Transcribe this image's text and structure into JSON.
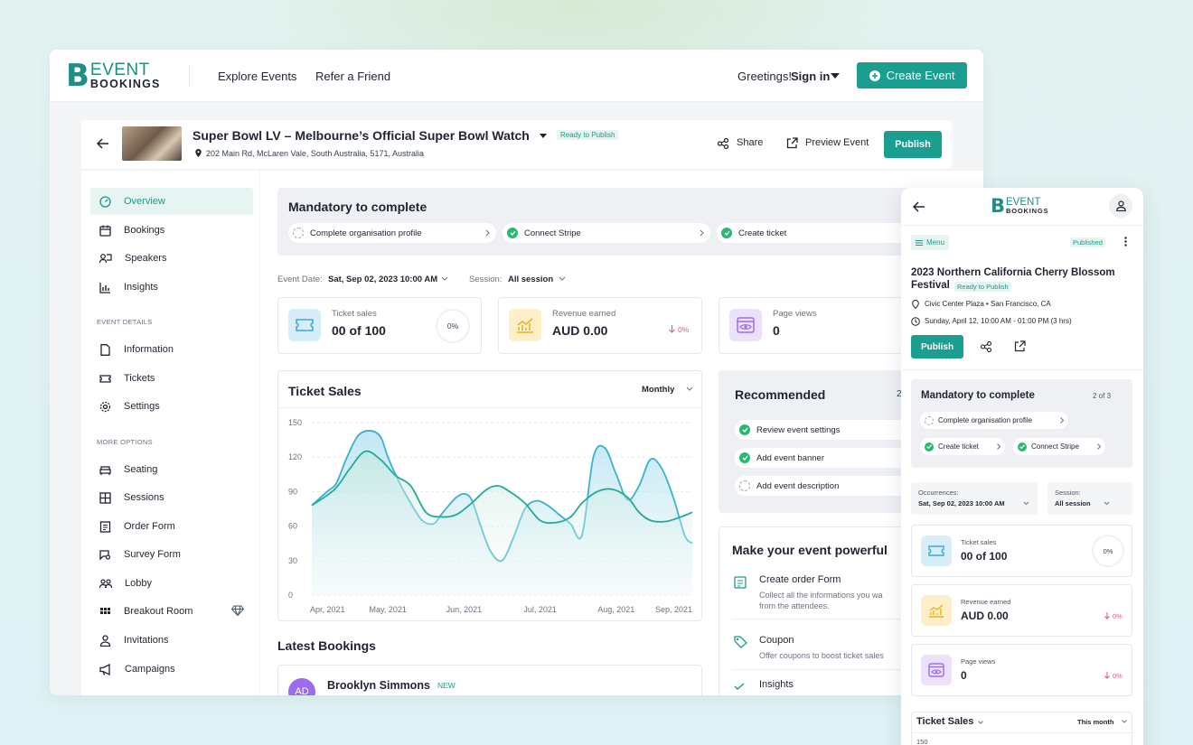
{
  "nav": {
    "logo_line1": "EVENT",
    "logo_line2": "BOOKINGS",
    "explore": "Explore Events",
    "refer": "Refer a Friend",
    "greeting": "Greetings!",
    "signin": "Sign in",
    "create": "Create Event"
  },
  "event": {
    "title": "Super Bowl LV – Melbourne’s Official Super Bowl Watch",
    "status": "Ready to Publish",
    "address": "202 Main Rd, McLaren Vale, South Australia, 5171, Australia",
    "share": "Share",
    "preview": "Preview Event",
    "publish": "Publish"
  },
  "sidebar": {
    "overview": "Overview",
    "bookings": "Bookings",
    "speakers": "Speakers",
    "insights": "Insights",
    "sec_details": "EVENT DETAILS",
    "information": "Information",
    "tickets": "Tickets",
    "settings": "Settings",
    "sec_more": "MORE OPTIONS",
    "seating": "Seating",
    "sessions": "Sessions",
    "order_form": "Order Form",
    "survey_form": "Survey Form",
    "lobby": "Lobby",
    "breakout": "Breakout Room",
    "invitations": "Invitations",
    "campaigns": "Campaigns"
  },
  "mandatory": {
    "title": "Mandatory to complete",
    "item1": "Complete organisation profile",
    "item2": "Connect Stripe",
    "item3": "Create ticket"
  },
  "filters": {
    "date_label": "Event Date:",
    "date_value": "Sat, Sep 02, 2023 10:00 AM",
    "session_label": "Session:",
    "session_value": "All session"
  },
  "stats": {
    "tickets_label": "Ticket sales",
    "tickets_value": "00 of 100",
    "tickets_pct": "0%",
    "revenue_label": "Revenue earned",
    "revenue_value": "AUD 0.00",
    "revenue_change": "0%",
    "views_label": "Page views",
    "views_value": "0"
  },
  "chart_data": {
    "type": "area",
    "title": "Ticket Sales",
    "period": "Monthly",
    "categories": [
      "Apr, 2021",
      "May, 2021",
      "Jun, 2021",
      "Jul, 2021",
      "Aug, 2021",
      "Sep, 2021"
    ],
    "yticks": [
      150,
      120,
      90,
      60,
      30,
      0
    ],
    "ylim": [
      0,
      150
    ],
    "series": [
      {
        "x": [
          0,
          0.2,
          0.32,
          0.45,
          0.6,
          0.75,
          0.9,
          1,
          1.15,
          1.3,
          1.45,
          1.6,
          1.7,
          1.8,
          1.9,
          2.0,
          2.1,
          2.22,
          2.35,
          2.5,
          2.65,
          2.8,
          2.95,
          3.1,
          3.25,
          3.4,
          3.55,
          3.7,
          3.85,
          4.0,
          4.15,
          4.3,
          4.45,
          4.6,
          4.75,
          4.9,
          5.0
        ],
        "y": [
          78,
          90,
          97,
          118,
          138,
          143,
          138,
          120,
          98,
          80,
          65,
          62,
          70,
          78,
          85,
          88,
          83,
          60,
          38,
          30,
          50,
          75,
          82,
          78,
          70,
          62,
          52,
          120,
          128,
          105,
          83,
          95,
          118,
          110,
          85,
          52,
          45
        ]
      },
      {
        "x": [
          0,
          0.3,
          0.5,
          0.7,
          0.9,
          1.1,
          1.3,
          1.5,
          1.7,
          1.9,
          2.1,
          2.3,
          2.45,
          2.6,
          2.8,
          3.0,
          3.2,
          3.4,
          3.55,
          3.75,
          3.95,
          4.15,
          4.3,
          4.45,
          4.65,
          4.85,
          5.0
        ],
        "y": [
          78,
          92,
          110,
          125,
          118,
          104,
          95,
          72,
          68,
          70,
          80,
          92,
          95,
          90,
          80,
          65,
          63,
          68,
          80,
          90,
          92,
          85,
          72,
          65,
          64,
          68,
          72
        ]
      }
    ]
  },
  "recommended": {
    "title": "Recommended",
    "count": "2",
    "item1": "Review event settings",
    "item2": "Add event banner",
    "item3": "Add event description"
  },
  "powerful": {
    "title": "Make your event powerful",
    "i1_title": "Create order Form",
    "i1_desc1": "Collect all the informations you wa",
    "i1_desc2": "from the attendees.",
    "i2_title": "Coupon",
    "i2_desc": "Offer coupons to boost ticket sales",
    "i3_title": "Insights"
  },
  "bookings": {
    "title": "Latest Bookings",
    "initials": "AD",
    "name": "Brooklyn Simmons",
    "badge": "NEW"
  },
  "mobile": {
    "menu": "Menu",
    "published": "Published",
    "event_title1": "2023 Northern California Cherry Blossom",
    "event_title2": "Festival",
    "status": "Ready to Publish",
    "location": "Civic Center Plaza • San Francisco, CA",
    "datetime": "Sunday, April 12, 10:00 AM - 01:00 PM (3 hrs)",
    "publish": "Publish",
    "mandatory_title": "Mandatory to complete",
    "mandatory_count": "2 of 3",
    "m_item1": "Complete organisation profile",
    "m_item2": "Create ticket",
    "m_item3": "Connect Stripe",
    "occ_label": "Occurrences:",
    "occ_value": "Sat, Sep 02, 2023 10:00 AM",
    "sess_label": "Session:",
    "sess_value": "All session",
    "ts_label": "Ticket sales",
    "ts_value": "00 of 100",
    "ts_pct": "0%",
    "rev_label": "Revenue earned",
    "rev_value": "AUD 0.00",
    "rev_change": "0%",
    "pv_label": "Page views",
    "pv_value": "0",
    "pv_change": "0%",
    "chart_title": "Ticket Sales",
    "chart_period": "This month",
    "chart_ytop": "150"
  },
  "colors": {
    "accent": "#1a9e8f",
    "success": "#27b96e",
    "down": "#e0567a"
  }
}
